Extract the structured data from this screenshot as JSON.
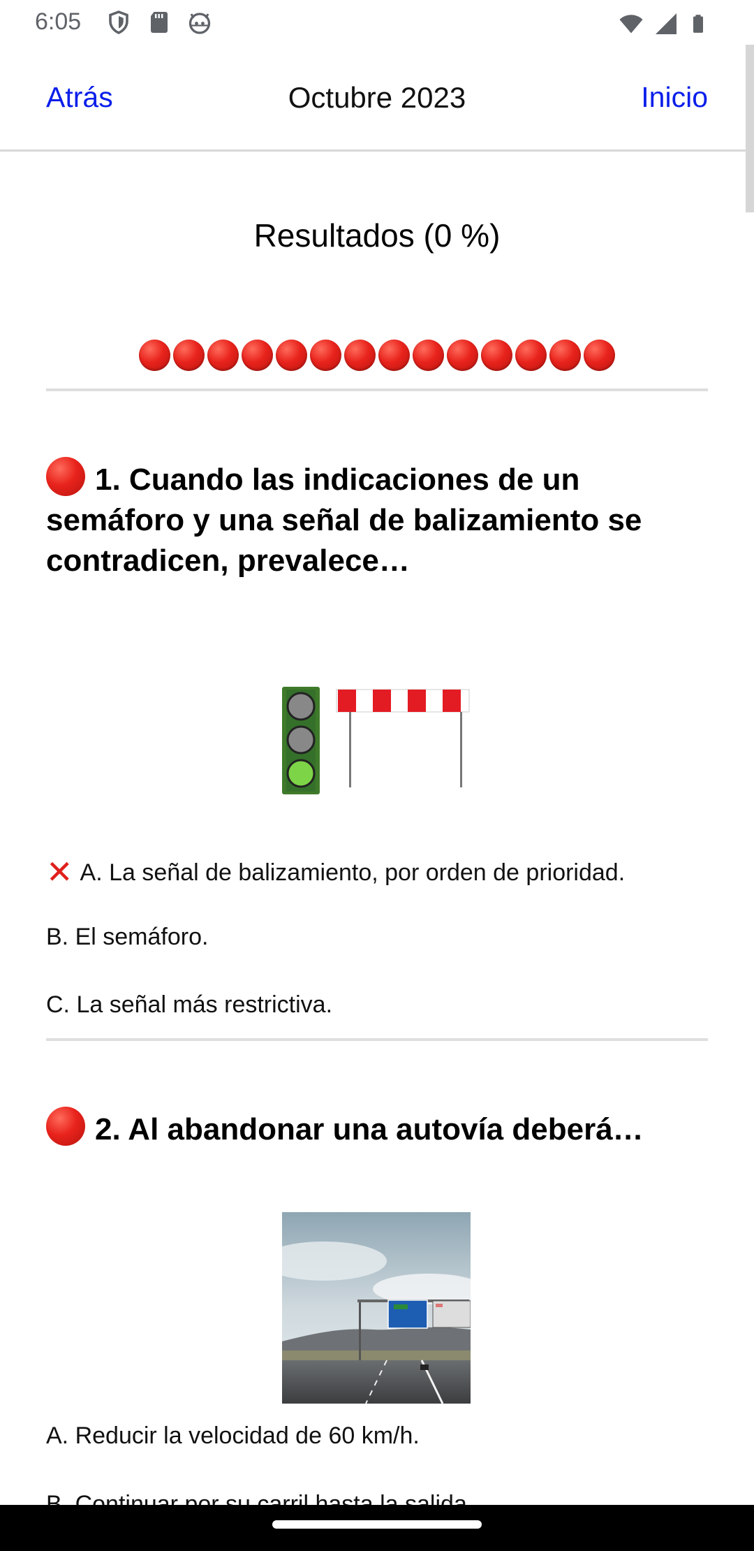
{
  "status_bar": {
    "time": "6:05",
    "left_icons": [
      "shield-icon",
      "sd-card-icon",
      "android-icon"
    ],
    "right_icons": [
      "wifi-icon",
      "signal-icon",
      "battery-icon"
    ]
  },
  "nav": {
    "back_label": "Atrás",
    "title": "Octubre 2023",
    "home_label": "Inicio",
    "link_color": "#0a1eea"
  },
  "results": {
    "title": "Resultados (0 %)",
    "dot_count": 14,
    "dot_color": "#e8231c"
  },
  "questions": [
    {
      "title": "1. Cuando las indicaciones de un semáforo y una señal de balizamiento se contradicen, prevalece…",
      "status_icon": "red-circle-icon",
      "image": "traffic-light-and-barrier-illustration",
      "answers": [
        {
          "text": "A. La señal de balizamiento, por orden de prioridad.",
          "marked_wrong": true
        },
        {
          "text": "B. El semáforo.",
          "marked_wrong": false
        },
        {
          "text": "C. La señal más restrictiva.",
          "marked_wrong": false
        }
      ]
    },
    {
      "title": "2. Al abandonar una autovía deberá…",
      "status_icon": "red-circle-icon",
      "image": "highway-exit-photo",
      "answers": [
        {
          "text": "A. Reducir la velocidad de 60 km/h.",
          "marked_wrong": false
        },
        {
          "text": "B. Continuar por su carril hasta la salida.",
          "marked_wrong": false
        }
      ]
    }
  ]
}
